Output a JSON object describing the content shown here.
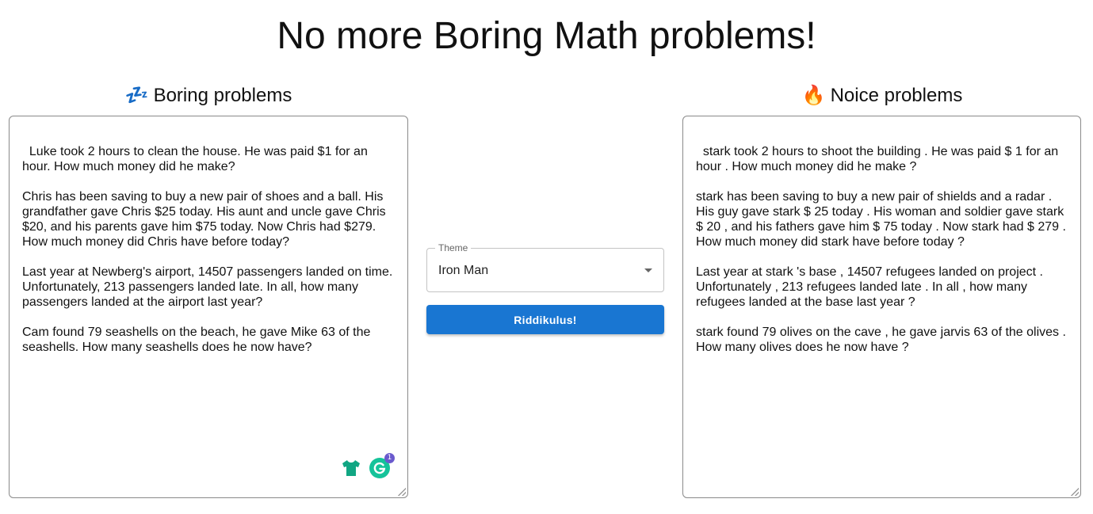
{
  "title": "No more Boring Math problems!",
  "boring": {
    "emoji": "💤",
    "heading": "Boring problems",
    "text": "Luke took 2 hours to clean the house. He was paid $1 for an hour. How much money did he make?\n\nChris has been saving to buy a new pair of shoes and a ball. His grandfather gave Chris $25 today. His aunt and uncle gave Chris $20, and his parents gave him $75 today. Now Chris had $279. How much money did Chris have before today?\n\nLast year at Newberg's airport, 14507 passengers landed on time. Unfortunately, 213 passengers landed late. In all, how many passengers landed at the airport last year?\n\nCam found 79 seashells on the beach, he gave Mike 63 of the seashells. How many seashells does he now have?",
    "grammarly_badge": "1"
  },
  "noice": {
    "emoji": "🔥",
    "heading": "Noice problems",
    "text": "stark took 2 hours to shoot the building . He was paid $ 1 for an hour . How much money did he make ?\n\nstark has been saving to buy a new pair of shields and a radar . His guy gave stark $ 25 today . His woman and soldier gave stark $ 20 , and his fathers gave him $ 75 today . Now stark had $ 279 . How much money did stark have before today ?\n\nLast year at stark 's base , 14507 refugees landed on project . Unfortunately , 213 refugees landed late . In all , how many refugees landed at the base last year ?\n\nstark found 79 olives on the cave , he gave jarvis 63 of the olives . How many olives does he now have ?"
  },
  "theme": {
    "label": "Theme",
    "value": "Iron Man"
  },
  "button_label": "Riddikulus!",
  "colors": {
    "button": "#1976d2",
    "grammarly": "#15c39a",
    "shirt": "#11a683",
    "badge": "#6a5acd"
  }
}
